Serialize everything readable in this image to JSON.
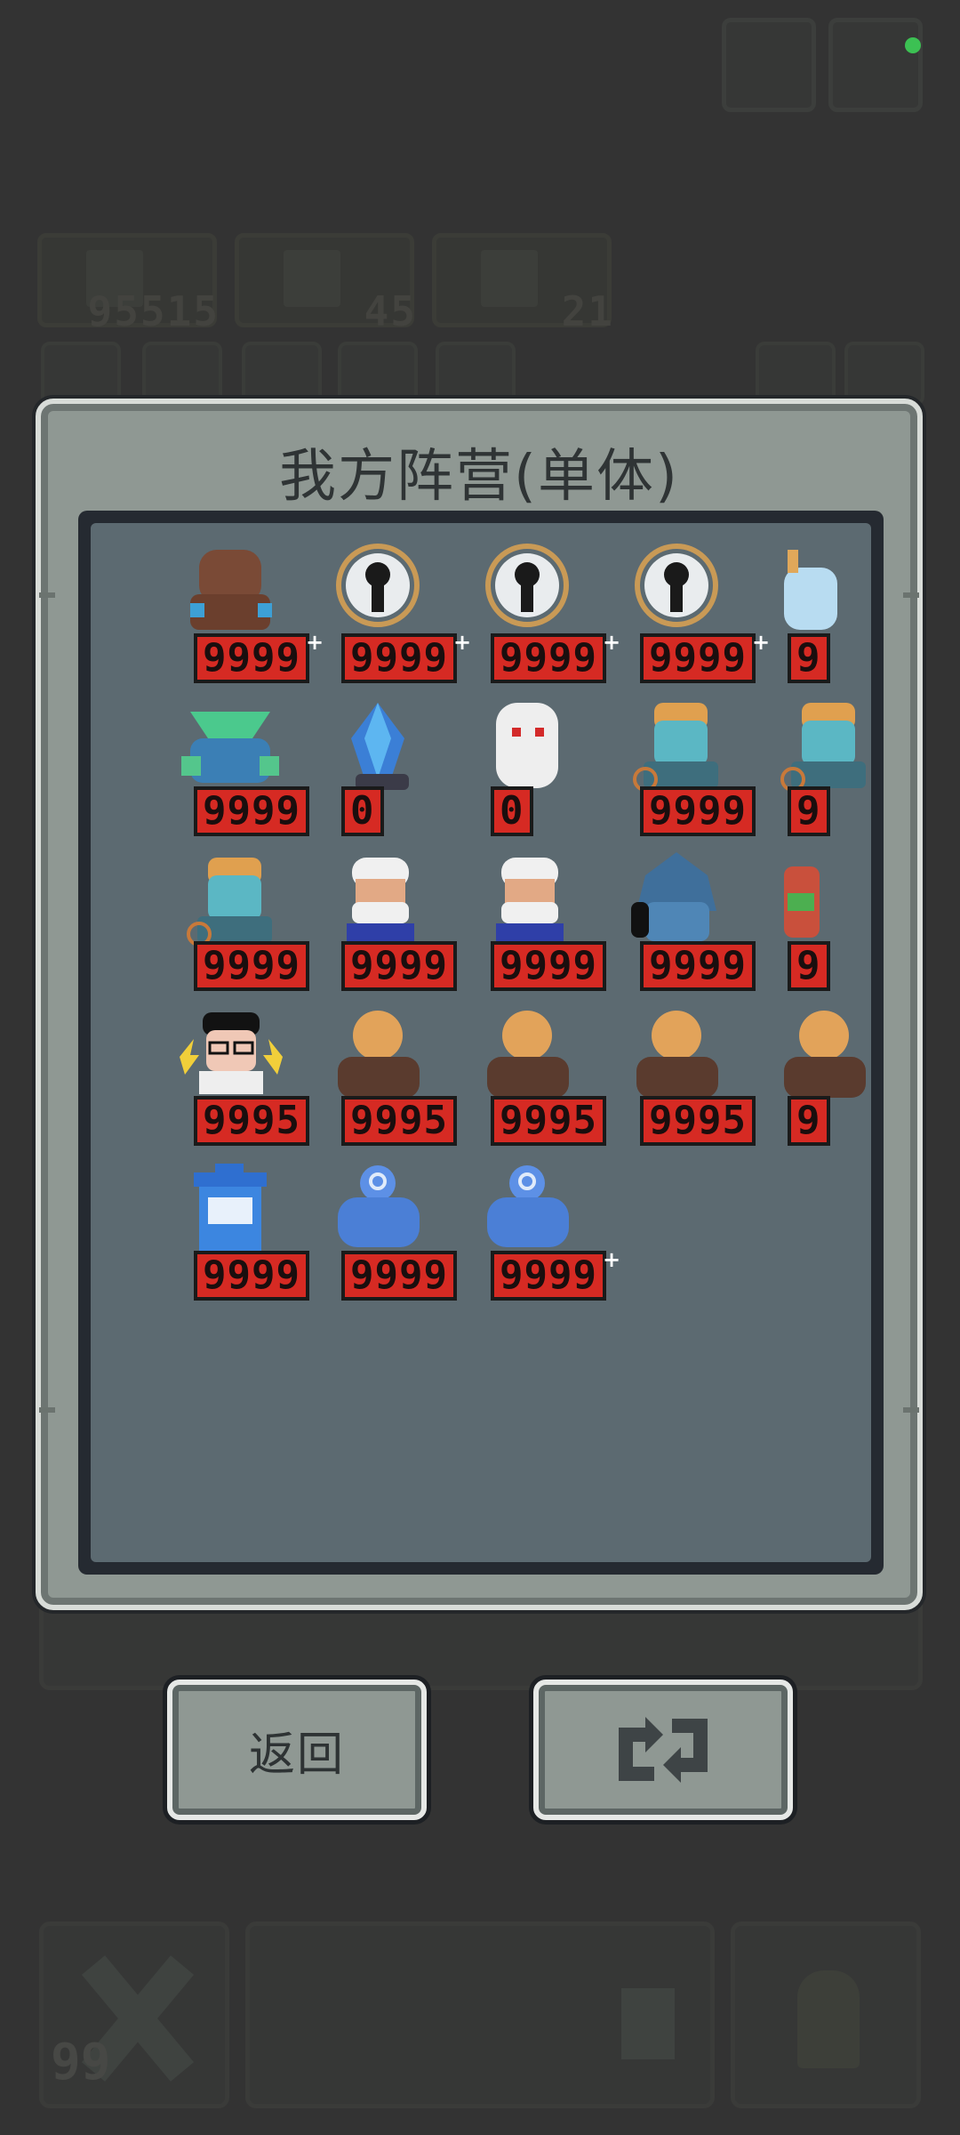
{
  "title": "我方阵营(单体)",
  "background": {
    "resources": [
      {
        "icon": "tree-icon",
        "value": "95515"
      },
      {
        "icon": "gem-icon",
        "value": "45"
      },
      {
        "icon": "skull-icon",
        "value": "21"
      }
    ],
    "bottom_count": "99"
  },
  "units": [
    {
      "icon": "brown-beast-icon",
      "hp": "9999",
      "plus": true
    },
    {
      "icon": "ghost-halo-icon",
      "hp": "9999",
      "plus": true
    },
    {
      "icon": "ghost-halo-icon",
      "hp": "9999",
      "plus": true
    },
    {
      "icon": "ghost-halo-icon",
      "hp": "9999",
      "plus": true
    },
    {
      "icon": "ice-spirit-icon",
      "hp": "9",
      "plus": false
    },
    {
      "icon": "green-plant-creature-icon",
      "hp": "9999",
      "plus": false
    },
    {
      "icon": "blue-crystal-icon",
      "hp": "0",
      "plus": false
    },
    {
      "icon": "white-yeti-icon",
      "hp": "0",
      "plus": false
    },
    {
      "icon": "blue-zombie-icon",
      "hp": "9999",
      "plus": false
    },
    {
      "icon": "blue-zombie-icon",
      "hp": "9",
      "plus": false
    },
    {
      "icon": "blue-zombie-icon",
      "hp": "9999",
      "plus": false
    },
    {
      "icon": "old-wizard-icon",
      "hp": "9999",
      "plus": false
    },
    {
      "icon": "old-wizard-icon",
      "hp": "9999",
      "plus": false
    },
    {
      "icon": "spiky-blue-demon-icon",
      "hp": "9999",
      "plus": false
    },
    {
      "icon": "red-dragon-icon",
      "hp": "9",
      "plus": false
    },
    {
      "icon": "nerd-glasses-icon",
      "hp": "9995",
      "plus": false
    },
    {
      "icon": "bald-brute-icon",
      "hp": "9995",
      "plus": false
    },
    {
      "icon": "bald-brute-icon",
      "hp": "9995",
      "plus": false
    },
    {
      "icon": "bald-brute-icon",
      "hp": "9995",
      "plus": false
    },
    {
      "icon": "bald-brute-icon",
      "hp": "9",
      "plus": false
    },
    {
      "icon": "blue-trashcan-icon",
      "hp": "9999",
      "plus": false
    },
    {
      "icon": "blue-golem-icon",
      "hp": "9999",
      "plus": false
    },
    {
      "icon": "blue-golem-icon",
      "hp": "9999",
      "plus": true
    }
  ],
  "buttons": {
    "back": "返回",
    "refresh_icon": "refresh-icon"
  },
  "colors": {
    "panel": "#8f9893",
    "grid_bg": "#5c6a71",
    "hp_red": "#d62a23",
    "page_bg": "#333333"
  }
}
